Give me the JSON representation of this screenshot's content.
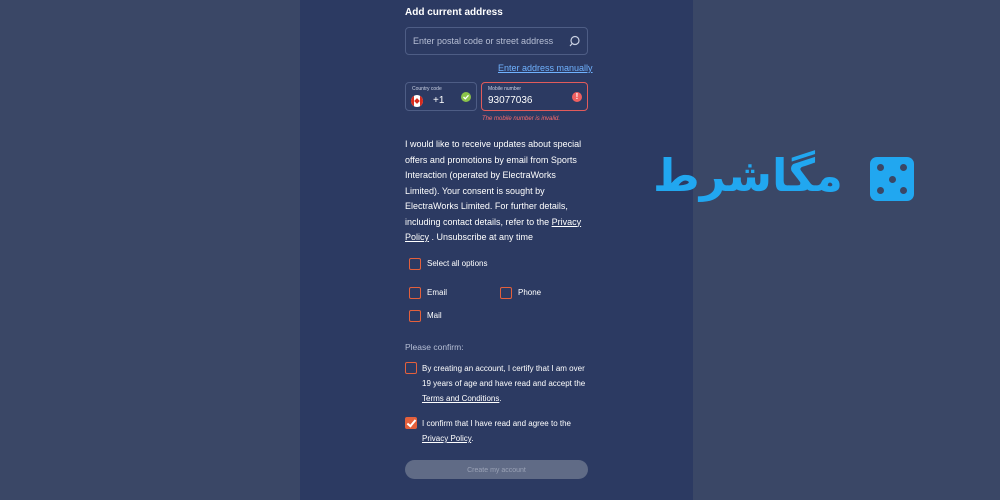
{
  "address": {
    "heading": "Add current address",
    "search_placeholder": "Enter postal code or street address",
    "manual_link": "Enter address manually"
  },
  "phone": {
    "country_label": "Country code",
    "country_code": "+1",
    "mobile_label": "Mobile number",
    "mobile_value": "93077036",
    "error": "The mobile number is invalid."
  },
  "consent": {
    "text_before": "I would like to receive updates about special offers and promotions by email from Sports Interaction (operated by ElectraWorks Limited). Your consent is sought by ElectraWorks Limited. For further details, including contact details, refer to the ",
    "privacy_link": "Privacy Policy",
    "text_after": " . Unsubscribe at any time"
  },
  "options": {
    "select_all": "Select all options",
    "email": "Email",
    "phone": "Phone",
    "mail": "Mail",
    "select_all_checked": false,
    "email_checked": false,
    "phone_checked": false,
    "mail_checked": false
  },
  "confirm": {
    "title": "Please confirm:",
    "age_text": "By creating an account, I certify that I am over 19 years of age and have read and accept the ",
    "terms_link": "Terms and Conditions",
    "age_end": ".",
    "age_checked": false,
    "privacy_text": "I confirm that I have read and agree to the ",
    "privacy_link": "Privacy Policy",
    "privacy_end": ".",
    "privacy_checked": true
  },
  "create_button": "Create my account",
  "logo": {
    "text": "مگاشرط",
    "icon": "dice-icon"
  },
  "colors": {
    "panel": "#2c3a62",
    "background": "#3a4766",
    "accent": "#e4603c",
    "link": "#6fb2ff",
    "error": "#ff6b6b",
    "logo": "#21a7f0"
  }
}
